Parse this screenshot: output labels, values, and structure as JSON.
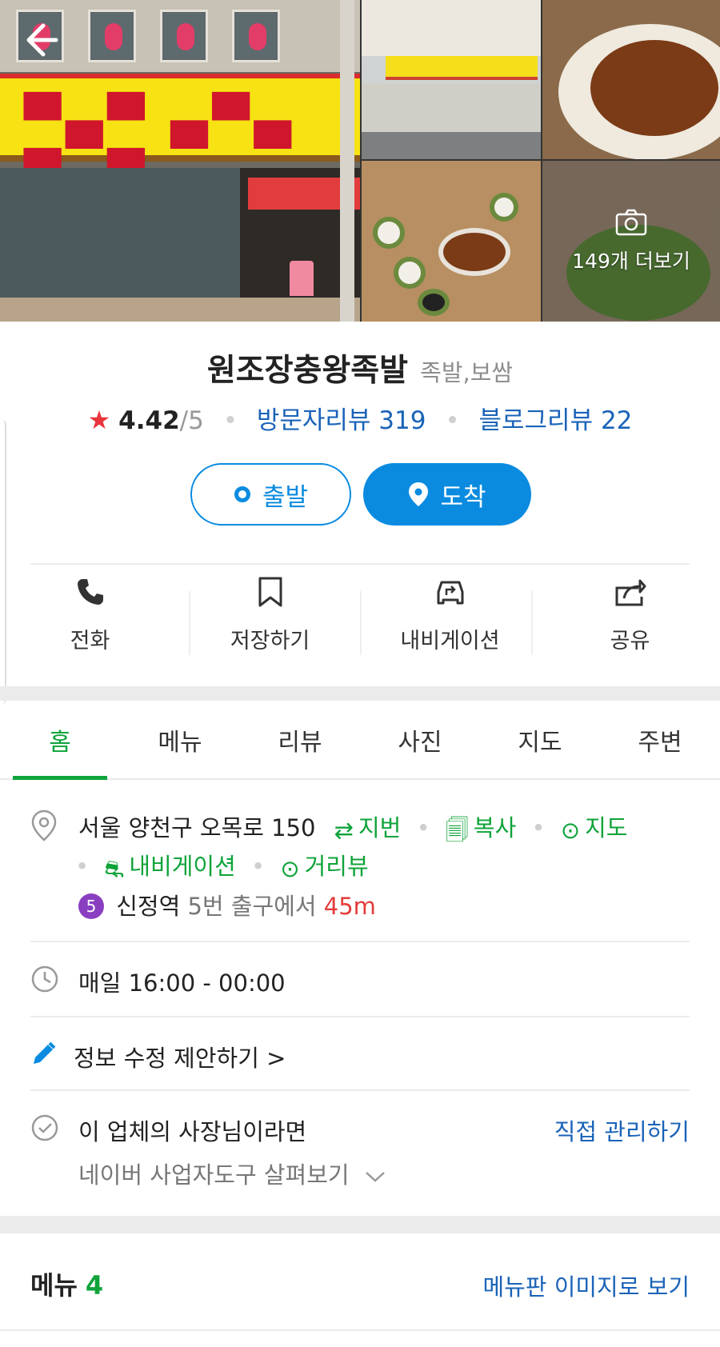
{
  "header": {
    "more_photos_label": "149개 더보기"
  },
  "place": {
    "name": "원조장충왕족발",
    "category": "족발,보쌈",
    "rating": "4.42",
    "rating_max": "/5",
    "visitor_reviews_label": "방문자리뷰 319",
    "blog_reviews_label": "블로그리뷰 22"
  },
  "route_buttons": {
    "start_label": "출발",
    "arrive_label": "도착"
  },
  "actions": [
    {
      "label": "전화",
      "icon": "phone-icon"
    },
    {
      "label": "저장하기",
      "icon": "bookmark-icon"
    },
    {
      "label": "내비게이션",
      "icon": "navigation-car-icon"
    },
    {
      "label": "공유",
      "icon": "share-icon"
    }
  ],
  "tabs": [
    {
      "label": "홈",
      "active": true
    },
    {
      "label": "메뉴",
      "active": false
    },
    {
      "label": "리뷰",
      "active": false
    },
    {
      "label": "사진",
      "active": false
    },
    {
      "label": "지도",
      "active": false
    },
    {
      "label": "주변",
      "active": false
    }
  ],
  "address": {
    "text": "서울 양천구 오목로 150",
    "lot_number_label": "지번",
    "copy_label": "복사",
    "map_label": "지도",
    "navigation_label": "내비게이션",
    "street_view_label": "거리뷰"
  },
  "subway": {
    "line": "5",
    "station": "신정역",
    "exit_text": "5번 출구에서",
    "distance": "45m"
  },
  "hours": {
    "text": "매일 16:00 - 00:00"
  },
  "suggest_edit": {
    "label": "정보 수정 제안하기 >"
  },
  "owner": {
    "text": "이 업체의 사장님이라면",
    "manage_label": "직접 관리하기",
    "tools_label": "네이버 사업자도구 살펴보기"
  },
  "menu_section": {
    "title": "메뉴",
    "count": "4",
    "image_link": "메뉴판 이미지로 보기"
  },
  "colors": {
    "naver_green": "#0fa33a",
    "primary_blue": "#0a8be0",
    "link_blue": "#1a63b8",
    "star_red": "#e8343b",
    "subway_line5": "#8a3fc1"
  }
}
